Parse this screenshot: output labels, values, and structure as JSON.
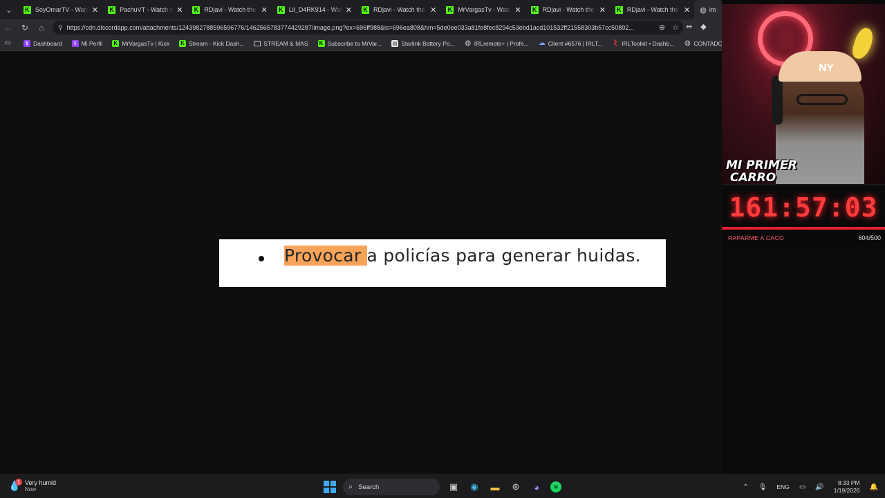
{
  "browser": {
    "tabs": [
      {
        "title": "SoyOmarTV - Watch the"
      },
      {
        "title": "PachuVT - Watch the VO"
      },
      {
        "title": "RDjavi - Watch the VOD"
      },
      {
        "title": "Lil_D4RK914 - Watch th"
      },
      {
        "title": "RDjavi - Watch the VOD"
      },
      {
        "title": "MrVargasTv - Watch the"
      },
      {
        "title": "RDjavi - Watch the VOD"
      },
      {
        "title": "RDjavi - Watch the VOD"
      }
    ],
    "active_tab_title": "im",
    "url": "https://cdn.discordapp.com/attachments/1243982788596596776/1462565783774429287/image.png?ex=696ff988&is=696ea808&hm=5de0ee033a81fe8fec8294c53ebd1acd101532ff21558303b57cc50892...",
    "bookmarks": [
      {
        "label": "Dashboard",
        "icon": "twitch"
      },
      {
        "label": "Mi Perfil",
        "icon": "twitch"
      },
      {
        "label": "MrVargasTv | Kick",
        "icon": "kick"
      },
      {
        "label": "Stream - Kick Dash...",
        "icon": "kick"
      },
      {
        "label": "STREAM & MAS",
        "icon": "folder"
      },
      {
        "label": "Subscribe to MrVar...",
        "icon": "kick"
      },
      {
        "label": "Starlink Battery Po...",
        "icon": "gray"
      },
      {
        "label": "IRLremote+ | Profe...",
        "icon": "globe"
      },
      {
        "label": "Client #6576 | IRLT...",
        "icon": "blue"
      },
      {
        "label": "IRLToolkit • Dashb...",
        "icon": "red"
      },
      {
        "label": "CONTADOR",
        "icon": "globe"
      }
    ]
  },
  "content": {
    "highlighted": "Provocar",
    "rest": "a policías para generar huidas."
  },
  "overlay": {
    "cam_text_line1": "MI PRIMER",
    "cam_text_line2": "CARRO",
    "timer": "161:57:03",
    "goal_label": "RAPARME A CACO",
    "goal_count": "604/500",
    "goal_progress": 1.0
  },
  "taskbar": {
    "weather_title": "Very humid",
    "weather_sub": "Now",
    "weather_badge": "1",
    "search_label": "Search",
    "lang": "ENG",
    "time": "8:33 PM",
    "date": "1/19/2026"
  }
}
